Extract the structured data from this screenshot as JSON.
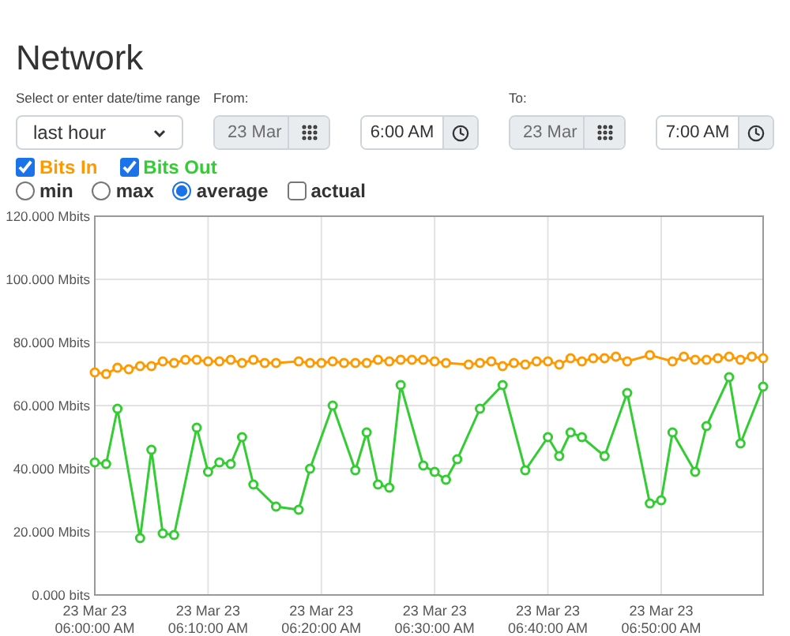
{
  "title": "Network",
  "range": {
    "label": "Select or enter date/time range",
    "value": "last hour"
  },
  "from": {
    "label": "From:",
    "date": "23 Mar",
    "time": "6:00 AM"
  },
  "to": {
    "label": "To:",
    "date": "23 Mar",
    "time": "7:00 AM"
  },
  "series_toggles": [
    {
      "label": "Bits In",
      "checked": true,
      "color": "#ff9900"
    },
    {
      "label": "Bits Out",
      "checked": true,
      "color": "#33cc33"
    }
  ],
  "modes": [
    {
      "label": "min",
      "kind": "radio",
      "selected": false
    },
    {
      "label": "max",
      "kind": "radio",
      "selected": false
    },
    {
      "label": "average",
      "kind": "radio",
      "selected": true
    },
    {
      "label": "actual",
      "kind": "checkbox",
      "checked": false
    }
  ],
  "chart_data": {
    "type": "line",
    "categories": [
      "23 Mar 23\n06:00:00 AM",
      null,
      null,
      null,
      null,
      null,
      null,
      null,
      null,
      null,
      "23 Mar 23\n06:10:00 AM",
      null,
      null,
      null,
      null,
      null,
      null,
      null,
      null,
      null,
      "23 Mar 23\n06:20:00 AM",
      null,
      null,
      null,
      null,
      null,
      null,
      null,
      null,
      null,
      "23 Mar 23\n06:30:00 AM",
      null,
      null,
      null,
      null,
      null,
      null,
      null,
      null,
      null,
      "23 Mar 23\n06:40:00 AM",
      null,
      null,
      null,
      null,
      null,
      null,
      null,
      null,
      null,
      "23 Mar 23\n06:50:00 AM",
      null,
      null,
      null,
      null,
      null,
      null,
      null,
      null,
      null
    ],
    "series": [
      {
        "color": "#ff9900",
        "marker": "circle",
        "values": [
          70.5,
          70,
          72,
          71.5,
          72.5,
          72.5,
          74,
          73.5,
          74.5,
          74.5,
          74,
          74,
          74.5,
          73.5,
          74.5,
          73.5,
          73.5,
          null,
          74,
          73.5,
          73.5,
          74,
          73.5,
          73.5,
          73.5,
          74.5,
          74,
          74.5,
          74.5,
          74.5,
          74,
          73.5,
          null,
          73,
          73.5,
          74,
          72.5,
          73.5,
          73,
          74,
          74,
          73,
          75,
          74,
          75,
          75,
          75.5,
          74,
          null,
          76,
          null,
          74,
          75.5,
          74.5,
          74.5,
          75,
          75.5,
          74.5,
          75.5,
          75
        ]
      },
      {
        "color": "#33cc33",
        "marker": "circle",
        "values": [
          42,
          41.5,
          59,
          null,
          18,
          46,
          19.5,
          19,
          null,
          53,
          39,
          42,
          41.5,
          50,
          35,
          null,
          28,
          null,
          27,
          40,
          null,
          60,
          null,
          39.5,
          51.5,
          35,
          34,
          66.5,
          null,
          41,
          39,
          36.5,
          43,
          null,
          59,
          null,
          66.5,
          null,
          39.5,
          null,
          50,
          44,
          51.5,
          50,
          null,
          44,
          null,
          64,
          null,
          29,
          30,
          51.5,
          null,
          39,
          53.5,
          null,
          69,
          48,
          null,
          66
        ]
      }
    ],
    "ylim": [
      0,
      120
    ],
    "grid": true,
    "yticks": [
      {
        "value": 0,
        "label": "0.000 bits"
      },
      {
        "value": 20,
        "label": "20.000 Mbits"
      },
      {
        "value": 40,
        "label": "40.000 Mbits"
      },
      {
        "value": 60,
        "label": "60.000 Mbits"
      },
      {
        "value": 80,
        "label": "80.000 Mbits"
      },
      {
        "value": 100,
        "label": "100.000 Mbits"
      },
      {
        "value": 120,
        "label": "120.000 Mbits"
      }
    ]
  }
}
